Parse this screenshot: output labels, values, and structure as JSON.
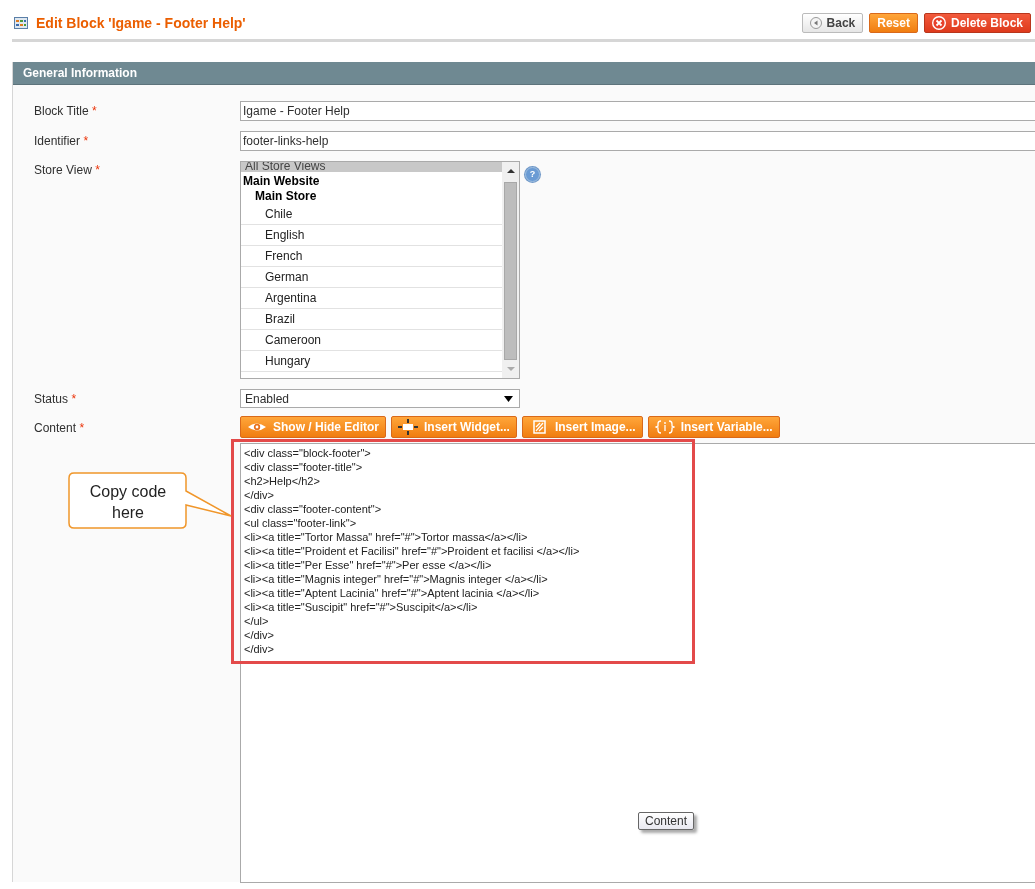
{
  "page": {
    "title": "Edit Block 'Igame - Footer Help'",
    "buttons": [
      {
        "label": "Back",
        "kind": "back"
      },
      {
        "label": "Reset",
        "kind": "reset"
      },
      {
        "label": "Delete Block",
        "kind": "delete"
      }
    ]
  },
  "section": {
    "title": "General Information",
    "fields": [
      {
        "kind": "text",
        "label": "Block Title",
        "required_mark": "*",
        "value": "Igame - Footer Help"
      },
      {
        "kind": "text",
        "label": "Identifier",
        "required_mark": "*",
        "value": "footer-links-help"
      },
      {
        "kind": "multiselect",
        "label": "Store View",
        "required_mark": "*",
        "help": "?",
        "options": [
          {
            "kind": "option",
            "label": "All Store Views",
            "selected": true
          },
          {
            "kind": "website",
            "label": "Main Website",
            "selected": false
          },
          {
            "kind": "store",
            "label": "Main Store",
            "selected": false
          },
          {
            "kind": "view",
            "label": "Chile",
            "selected": false
          },
          {
            "kind": "view",
            "label": "English",
            "selected": false
          },
          {
            "kind": "view",
            "label": "French",
            "selected": false
          },
          {
            "kind": "view",
            "label": "German",
            "selected": false
          },
          {
            "kind": "view",
            "label": "Argentina",
            "selected": false
          },
          {
            "kind": "view",
            "label": "Brazil",
            "selected": false
          },
          {
            "kind": "view",
            "label": "Cameroon",
            "selected": false
          },
          {
            "kind": "view",
            "label": "Hungary",
            "selected": false
          }
        ]
      },
      {
        "kind": "select",
        "label": "Status",
        "required_mark": "*",
        "value": "Enabled"
      },
      {
        "kind": "editor",
        "label": "Content",
        "required_mark": "*",
        "buttons": [
          {
            "label": "Show / Hide Editor",
            "kind": "eye"
          },
          {
            "label": "Insert Widget...",
            "kind": "widget"
          },
          {
            "label": "Insert Image...",
            "kind": "image"
          },
          {
            "label": "Insert Variable...",
            "kind": "variable"
          }
        ],
        "value": "<div class=\"block-footer\">\n<div class=\"footer-title\">\n<h2>Help</h2>\n</div>\n<div class=\"footer-content\">\n<ul class=\"footer-link\">\n<li><a title=\"Tortor Massa\" href=\"#\">Tortor massa</a></li>\n<li><a title=\"Proident et Facilisi\" href=\"#\">Proident et facilisi </a></li>\n<li><a title=\"Per Esse\" href=\"#\">Per esse </a></li>\n<li><a title=\"Magnis integer\" href=\"#\">Magnis integer </a></li>\n<li><a title=\"Aptent Lacinia\" href=\"#\">Aptent lacinia </a></li>\n<li><a title=\"Suscipit\" href=\"#\">Suscipit</a></li>\n</ul>\n</div>\n</div>",
        "tooltip": "Content"
      }
    ]
  },
  "annotation": {
    "callout": "Copy code here",
    "highlight": true
  }
}
